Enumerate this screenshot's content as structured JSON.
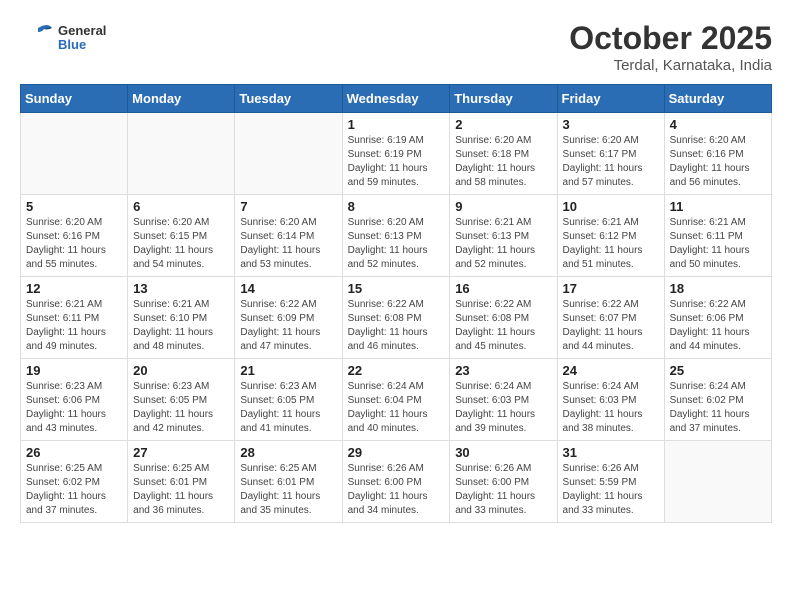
{
  "logo": {
    "text_general": "General",
    "text_blue": "Blue"
  },
  "header": {
    "month_year": "October 2025",
    "location": "Terdal, Karnataka, India"
  },
  "weekdays": [
    "Sunday",
    "Monday",
    "Tuesday",
    "Wednesday",
    "Thursday",
    "Friday",
    "Saturday"
  ],
  "days": [
    {
      "date": "",
      "sunrise": "",
      "sunset": "",
      "daylight": ""
    },
    {
      "date": "",
      "sunrise": "",
      "sunset": "",
      "daylight": ""
    },
    {
      "date": "",
      "sunrise": "",
      "sunset": "",
      "daylight": ""
    },
    {
      "date": "1",
      "sunrise": "6:19 AM",
      "sunset": "6:19 PM",
      "daylight": "11 hours and 59 minutes."
    },
    {
      "date": "2",
      "sunrise": "6:20 AM",
      "sunset": "6:18 PM",
      "daylight": "11 hours and 58 minutes."
    },
    {
      "date": "3",
      "sunrise": "6:20 AM",
      "sunset": "6:17 PM",
      "daylight": "11 hours and 57 minutes."
    },
    {
      "date": "4",
      "sunrise": "6:20 AM",
      "sunset": "6:16 PM",
      "daylight": "11 hours and 56 minutes."
    },
    {
      "date": "5",
      "sunrise": "6:20 AM",
      "sunset": "6:16 PM",
      "daylight": "11 hours and 55 minutes."
    },
    {
      "date": "6",
      "sunrise": "6:20 AM",
      "sunset": "6:15 PM",
      "daylight": "11 hours and 54 minutes."
    },
    {
      "date": "7",
      "sunrise": "6:20 AM",
      "sunset": "6:14 PM",
      "daylight": "11 hours and 53 minutes."
    },
    {
      "date": "8",
      "sunrise": "6:20 AM",
      "sunset": "6:13 PM",
      "daylight": "11 hours and 52 minutes."
    },
    {
      "date": "9",
      "sunrise": "6:21 AM",
      "sunset": "6:13 PM",
      "daylight": "11 hours and 52 minutes."
    },
    {
      "date": "10",
      "sunrise": "6:21 AM",
      "sunset": "6:12 PM",
      "daylight": "11 hours and 51 minutes."
    },
    {
      "date": "11",
      "sunrise": "6:21 AM",
      "sunset": "6:11 PM",
      "daylight": "11 hours and 50 minutes."
    },
    {
      "date": "12",
      "sunrise": "6:21 AM",
      "sunset": "6:11 PM",
      "daylight": "11 hours and 49 minutes."
    },
    {
      "date": "13",
      "sunrise": "6:21 AM",
      "sunset": "6:10 PM",
      "daylight": "11 hours and 48 minutes."
    },
    {
      "date": "14",
      "sunrise": "6:22 AM",
      "sunset": "6:09 PM",
      "daylight": "11 hours and 47 minutes."
    },
    {
      "date": "15",
      "sunrise": "6:22 AM",
      "sunset": "6:08 PM",
      "daylight": "11 hours and 46 minutes."
    },
    {
      "date": "16",
      "sunrise": "6:22 AM",
      "sunset": "6:08 PM",
      "daylight": "11 hours and 45 minutes."
    },
    {
      "date": "17",
      "sunrise": "6:22 AM",
      "sunset": "6:07 PM",
      "daylight": "11 hours and 44 minutes."
    },
    {
      "date": "18",
      "sunrise": "6:22 AM",
      "sunset": "6:06 PM",
      "daylight": "11 hours and 44 minutes."
    },
    {
      "date": "19",
      "sunrise": "6:23 AM",
      "sunset": "6:06 PM",
      "daylight": "11 hours and 43 minutes."
    },
    {
      "date": "20",
      "sunrise": "6:23 AM",
      "sunset": "6:05 PM",
      "daylight": "11 hours and 42 minutes."
    },
    {
      "date": "21",
      "sunrise": "6:23 AM",
      "sunset": "6:05 PM",
      "daylight": "11 hours and 41 minutes."
    },
    {
      "date": "22",
      "sunrise": "6:24 AM",
      "sunset": "6:04 PM",
      "daylight": "11 hours and 40 minutes."
    },
    {
      "date": "23",
      "sunrise": "6:24 AM",
      "sunset": "6:03 PM",
      "daylight": "11 hours and 39 minutes."
    },
    {
      "date": "24",
      "sunrise": "6:24 AM",
      "sunset": "6:03 PM",
      "daylight": "11 hours and 38 minutes."
    },
    {
      "date": "25",
      "sunrise": "6:24 AM",
      "sunset": "6:02 PM",
      "daylight": "11 hours and 37 minutes."
    },
    {
      "date": "26",
      "sunrise": "6:25 AM",
      "sunset": "6:02 PM",
      "daylight": "11 hours and 37 minutes."
    },
    {
      "date": "27",
      "sunrise": "6:25 AM",
      "sunset": "6:01 PM",
      "daylight": "11 hours and 36 minutes."
    },
    {
      "date": "28",
      "sunrise": "6:25 AM",
      "sunset": "6:01 PM",
      "daylight": "11 hours and 35 minutes."
    },
    {
      "date": "29",
      "sunrise": "6:26 AM",
      "sunset": "6:00 PM",
      "daylight": "11 hours and 34 minutes."
    },
    {
      "date": "30",
      "sunrise": "6:26 AM",
      "sunset": "6:00 PM",
      "daylight": "11 hours and 33 minutes."
    },
    {
      "date": "31",
      "sunrise": "6:26 AM",
      "sunset": "5:59 PM",
      "daylight": "11 hours and 33 minutes."
    }
  ],
  "labels": {
    "sunrise": "Sunrise:",
    "sunset": "Sunset:",
    "daylight": "Daylight:"
  }
}
